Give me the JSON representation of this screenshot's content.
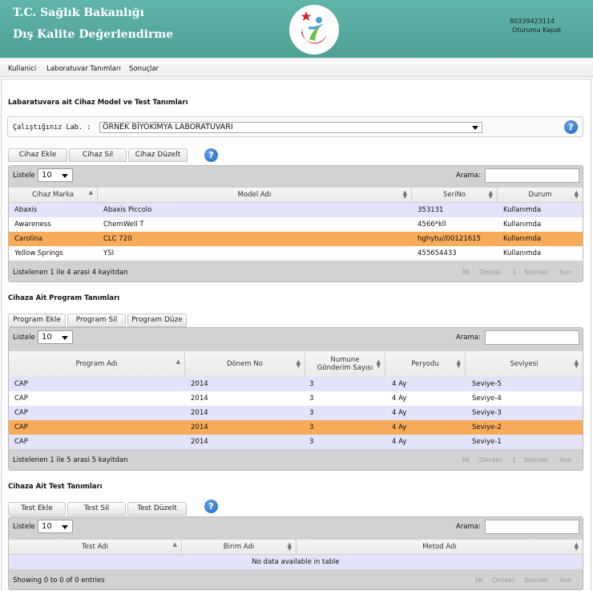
{
  "header": {
    "title_line1": "T.C. Sağlık Bakanlığı",
    "title_line2": "Dış Kalite Değerlendirme",
    "user_id": "80339423114",
    "logout_label": "Oturumu Kapat",
    "logo_icon": "ministry-crescent-star-logo"
  },
  "menu": [
    "Kullanici",
    "Laboratuvar Tanımları",
    "Sonuçlar"
  ],
  "device_section": {
    "title": "Labaratuvara ait Cihaz Model ve Test Tanımları",
    "lab_label": "Çalıştığınız Lab. :",
    "lab_value": "ÖRNEK BİYOKİMYA LABORATUVARI",
    "buttons": [
      "Cihaz Ekle",
      "Cihaz Sil",
      "Cihaz Düzelt"
    ],
    "table": {
      "length_label": "Listele",
      "length_value": "10",
      "search_label": "Arama:",
      "columns": [
        "Cihaz Marka",
        "Model Adı",
        "SeriNo",
        "Durum"
      ],
      "rows": [
        [
          "Abaxis",
          "Abaxis Piccolo",
          "353131",
          "Kullanımda"
        ],
        [
          "Awareness",
          "ChemWell T",
          "4566*kll",
          "Kullanımda"
        ],
        [
          "Carolina",
          "CLC 720",
          "hghytu//00121615",
          "Kullanımda"
        ],
        [
          "Yellow Springs",
          "YSI",
          "455654433",
          "Kullanımda"
        ]
      ],
      "selected_row": 2,
      "info": "Listelenen 1 ile 4 arasi 4 kayitdan",
      "pager": [
        "İlk",
        "Onceki",
        "1",
        "Sonraki",
        "Son"
      ]
    }
  },
  "program_section": {
    "title": "Cihaza Ait Program Tanımları",
    "buttons": [
      "Program Ekle",
      "Program Sil",
      "Program Düze"
    ],
    "table": {
      "length_label": "Listele",
      "length_value": "10",
      "search_label": "Arama:",
      "columns": [
        "Program Adı",
        "Dönem No",
        "Numune\nGönderim Sayısı",
        "Peryodu",
        "Seviyesi"
      ],
      "rows": [
        [
          "CAP",
          "2014",
          "3",
          "4 Ay",
          "Seviye-5"
        ],
        [
          "CAP",
          "2014",
          "3",
          "4 Ay",
          "Seviye-4"
        ],
        [
          "CAP",
          "2014",
          "3",
          "4 Ay",
          "Seviye-3"
        ],
        [
          "CAP",
          "2014",
          "3",
          "4 Ay",
          "Seviye-2"
        ],
        [
          "CAP",
          "2014",
          "3",
          "4 Ay",
          "Seviye-1"
        ]
      ],
      "selected_row": 3,
      "info": "Listelenen 1 ile 5 arasi 5 kayitdan",
      "pager": [
        "İlk",
        "Onceki",
        "1",
        "Sonraki",
        "Son"
      ]
    }
  },
  "test_section": {
    "title": "Cihaza Ait Test Tanımları",
    "buttons": [
      "Test Ekle",
      "Test Sil",
      "Test Düzelt"
    ],
    "table": {
      "length_label": "Listele",
      "length_value": "10",
      "search_label": "Arama:",
      "columns": [
        "Test Adı",
        "Birim Adı",
        "Metod Adı"
      ],
      "empty_message": "No data available in table",
      "info": "Showing 0 to 0 of 0 entries",
      "pager": [
        "İlk",
        "Önceki",
        "Sonraki",
        "Son"
      ]
    }
  },
  "colors": {
    "header_teal": "#5fb5a8",
    "row_stripe": "#e3e3fb",
    "row_selected": "#f8ac59",
    "help_blue": "#1f5fb8"
  }
}
